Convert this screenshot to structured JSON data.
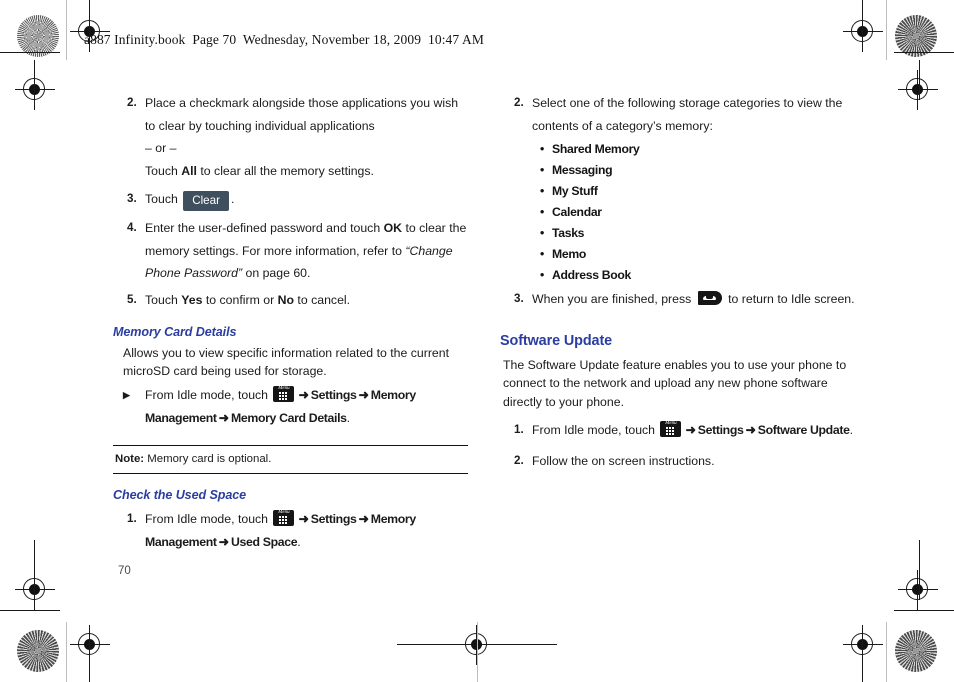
{
  "header": {
    "text": "a887 Infinity.book  Page 70  Wednesday, November 18, 2009  10:47 AM"
  },
  "page_number": "70",
  "colors": {
    "heading_blue": "#2b3ea0",
    "ui_button_bg": "#3f4f5d",
    "text": "#1b1b1b"
  },
  "left_column": {
    "steps": [
      {
        "num": "2.",
        "line1": "Place a checkmark alongside those applications you wish",
        "line2": "to clear by touching individual applications",
        "or": "– or –",
        "line3_pre": "Touch ",
        "line3_bold": "All",
        "line3_post": " to clear all the memory settings."
      },
      {
        "num": "3.",
        "pre": "Touch ",
        "button": "Clear",
        "post": "."
      },
      {
        "num": "4.",
        "pre": "Enter the user-defined password and touch ",
        "bold": "OK",
        "mid": " to clear the memory settings. For more information, refer to ",
        "italic": "“Change Phone Password”",
        "post": " on page 60."
      },
      {
        "num": "5.",
        "pre": "Touch ",
        "bold1": "Yes",
        "mid": " to confirm or ",
        "bold2": "No",
        "post": " to cancel."
      }
    ],
    "memory_card_details": {
      "heading": "Memory Card Details",
      "body_line1": "Allows you to view specific information related to the current",
      "body_line2": "microSD card being used for storage.",
      "bullet_marker": "▶",
      "nav_pre": "From Idle mode, touch ",
      "nav_icon": "menu-key-icon",
      "nav_arrow": "➜",
      "nav_item1": "Settings",
      "nav_item2": "Memory Management",
      "nav_item3": "Memory Card Details",
      "nav_end": "."
    },
    "note": {
      "label": "Note:",
      "text": " Memory card is optional."
    },
    "check_used_space": {
      "heading": "Check the Used Space",
      "step_num": "1.",
      "nav_pre": "From Idle mode, touch ",
      "nav_icon": "menu-key-icon",
      "nav_arrow": "➜",
      "nav_item1": "Settings",
      "nav_item2": "Memory Management",
      "nav_item3": "Used Space",
      "nav_end": "."
    }
  },
  "right_column": {
    "step2": {
      "num": "2.",
      "line1": "Select one of the following storage categories to view the",
      "line2": "contents of a category’s memory:"
    },
    "categories": [
      "Shared Memory",
      "Messaging",
      "My Stuff",
      "Calendar",
      "Tasks",
      "Memo",
      "Address Book"
    ],
    "step3": {
      "num": "3.",
      "pre": "When you are finished, press ",
      "icon": "end-call-key-icon",
      "post": " to return to Idle screen."
    },
    "software_update": {
      "heading": "Software Update",
      "body_line1": "The Software Update feature enables you to use your phone to",
      "body_line2": "connect to the network and upload any new phone software",
      "body_line3": "directly to your phone.",
      "step1_num": "1.",
      "step1_pre": "From Idle mode, touch ",
      "step1_icon": "menu-key-icon",
      "nav_arrow": "➜",
      "step1_item1": "Settings",
      "step1_item2": "Software Update",
      "step1_end": ".",
      "step2_num": "2.",
      "step2_text": "Follow the on screen instructions."
    }
  }
}
